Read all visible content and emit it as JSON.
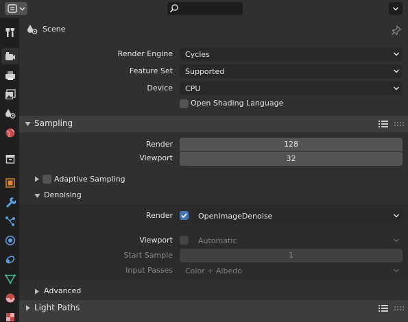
{
  "header": {
    "editor_icon": "properties-editor-icon",
    "search": {
      "value": "",
      "icon": "search-icon"
    }
  },
  "tabs": [
    {
      "name": "tool",
      "icon": "tool-icon",
      "active": false
    },
    {
      "name": "render",
      "icon": "render-icon",
      "active": true
    },
    {
      "name": "output",
      "icon": "output-icon",
      "active": false
    },
    {
      "name": "view-layer",
      "icon": "view-layer-icon",
      "active": false
    },
    {
      "name": "scene",
      "icon": "scene-icon",
      "active": false
    },
    {
      "name": "world",
      "icon": "world-icon",
      "active": false
    },
    {
      "name": "collection",
      "icon": "collection-icon",
      "active": false
    },
    {
      "name": "object",
      "icon": "object-icon",
      "active": false
    },
    {
      "name": "modifiers",
      "icon": "wrench-icon",
      "active": false
    },
    {
      "name": "particles",
      "icon": "particles-icon",
      "active": false
    },
    {
      "name": "physics",
      "icon": "physics-icon",
      "active": false
    },
    {
      "name": "constraints",
      "icon": "constraints-icon",
      "active": false
    },
    {
      "name": "data",
      "icon": "mesh-data-icon",
      "active": false
    },
    {
      "name": "material",
      "icon": "material-icon",
      "active": false
    },
    {
      "name": "texture",
      "icon": "texture-icon",
      "active": false
    }
  ],
  "context": {
    "title": "Scene"
  },
  "render": {
    "engine_label": "Render Engine",
    "engine_value": "Cycles",
    "feature_label": "Feature Set",
    "feature_value": "Supported",
    "device_label": "Device",
    "device_value": "CPU",
    "osl_label": "Open Shading Language",
    "osl_checked": false
  },
  "sampling": {
    "title": "Sampling",
    "render_label": "Render",
    "render_value": "128",
    "viewport_label": "Viewport",
    "viewport_value": "32",
    "adaptive_label": "Adaptive Sampling",
    "adaptive_checked": false,
    "denoising": {
      "title": "Denoising",
      "render_label": "Render",
      "render_checked": true,
      "render_value": "OpenImageDenoise",
      "viewport_label": "Viewport",
      "viewport_checked": false,
      "viewport_value": "Automatic",
      "start_label": "Start Sample",
      "start_value": "1",
      "passes_label": "Input Passes",
      "passes_value": "Color + Albedo"
    },
    "advanced_label": "Advanced"
  },
  "light_paths": {
    "title": "Light Paths"
  }
}
